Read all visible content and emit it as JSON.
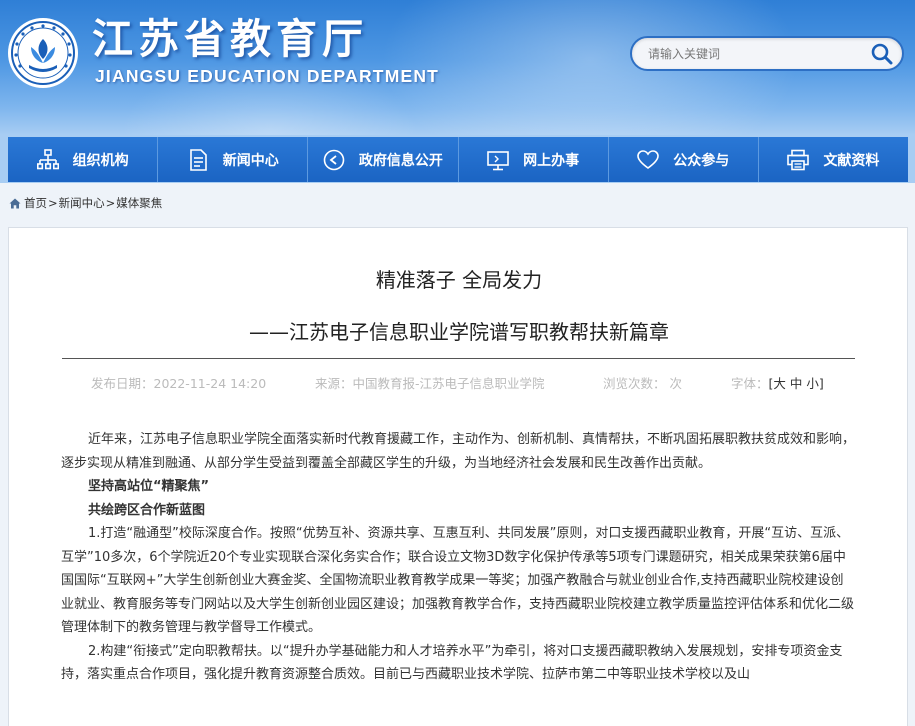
{
  "site": {
    "title": "江苏省教育厅",
    "subtitle": "JIANGSU EDUCATION DEPARTMENT"
  },
  "search": {
    "placeholder": "请输入关键词"
  },
  "nav": {
    "items": [
      {
        "label": "组织机构",
        "icon": "org-chart-icon"
      },
      {
        "label": "新闻中心",
        "icon": "document-icon"
      },
      {
        "label": "政府信息公开",
        "icon": "chat-bubble-icon"
      },
      {
        "label": "网上办事",
        "icon": "monitor-icon"
      },
      {
        "label": "公众参与",
        "icon": "heart-icon"
      },
      {
        "label": "文献资料",
        "icon": "printer-icon"
      }
    ]
  },
  "breadcrumb": {
    "home": "首页",
    "sep": ">",
    "news": "新闻中心",
    "current": "媒体聚焦"
  },
  "article": {
    "title": "精准落子 全局发力",
    "subtitle": "——江苏电子信息职业学院谱写职教帮扶新篇章",
    "meta": {
      "date": "发布日期：2022-11-24 14:20",
      "source": "来源：中国教育报-江苏电子信息职业学院",
      "views": "浏览次数：  次",
      "font_label": "字体：",
      "font_open": "[",
      "font_large": "大",
      "font_medium": "中",
      "font_small": "小",
      "font_close": "]"
    },
    "paragraphs": [
      {
        "text": "近年来，江苏电子信息职业学院全面落实新时代教育援藏工作，主动作为、创新机制、真情帮扶，不断巩固拓展职教扶贫成效和影响，逐步实现从精准到融通、从部分学生受益到覆盖全部藏区学生的升级，为当地经济社会发展和民生改善作出贡献。",
        "bold": false
      },
      {
        "text": "坚持高站位“精聚焦”",
        "bold": true
      },
      {
        "text": "共绘跨区合作新蓝图",
        "bold": true
      },
      {
        "text": "1.打造“融通型”校际深度合作。按照“优势互补、资源共享、互惠互利、共同发展”原则，对口支援西藏职业教育，开展“互访、互派、互学”10多次，6个学院近20个专业实现联合深化务实合作；联合设立文物3D数字化保护传承等5项专门课题研究，相关成果荣获第6届中国国际“互联网+”大学生创新创业大赛金奖、全国物流职业教育教学成果一等奖；加强产教融合与就业创业合作,支持西藏职业院校建设创业就业、教育服务等专门网站以及大学生创新创业园区建设；加强教育教学合作，支持西藏职业院校建立教学质量监控评估体系和优化二级管理体制下的教务管理与教学督导工作模式。",
        "bold": false
      },
      {
        "text": "2.构建“衔接式”定向职教帮扶。以“提升办学基础能力和人才培养水平”为牵引，将对口支援西藏职教纳入发展规划，安排专项资金支持，落实重点合作项目，强化提升教育资源整合质效。目前已与西藏职业技术学院、拉萨市第二中等职业技术学校以及山",
        "bold": false
      }
    ]
  },
  "colors": {
    "header_top": "#2f7fd6",
    "nav_bg": "#1f6cc9",
    "search_border": "#2d6fc4"
  }
}
